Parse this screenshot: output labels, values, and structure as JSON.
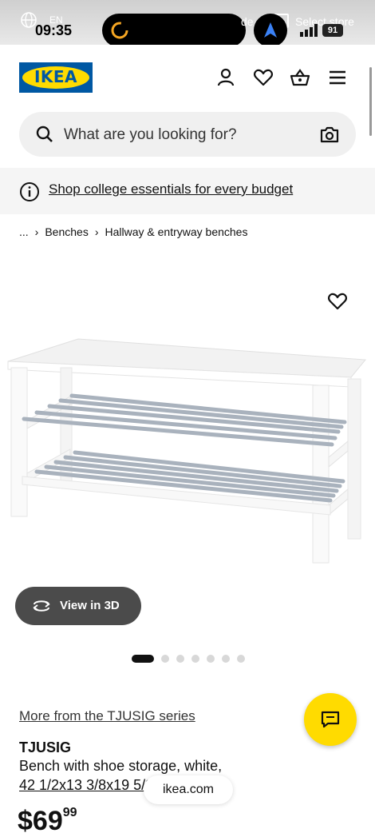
{
  "status_bar": {
    "time": "09:35",
    "lang": "EN",
    "store_label": "Select store",
    "mode_fragment": "de",
    "battery": "91"
  },
  "header": {
    "logo_text": "IKEA",
    "icons": [
      "user-icon",
      "heart-icon",
      "basket-icon",
      "menu-icon"
    ]
  },
  "search": {
    "placeholder": "What are you looking for?"
  },
  "banner": {
    "text": "Shop college essentials for every budget"
  },
  "breadcrumb": {
    "ellipsis": "...",
    "items": [
      "Benches",
      "Hallway & entryway benches"
    ]
  },
  "gallery": {
    "view3d_label": "View in 3D",
    "dot_count": 7,
    "active_dot": 0
  },
  "product": {
    "series_link": "More from the TJUSIG series",
    "name": "TJUSIG",
    "description": "Bench with shoe storage, white,",
    "dimensions": "42 1/2x13 3/8x19 5/8\"",
    "price_main": "$69",
    "price_cents": "99"
  },
  "browser": {
    "url": "ikea.com"
  },
  "colors": {
    "brand_blue": "#0058a3",
    "brand_yellow": "#ffdb00"
  }
}
